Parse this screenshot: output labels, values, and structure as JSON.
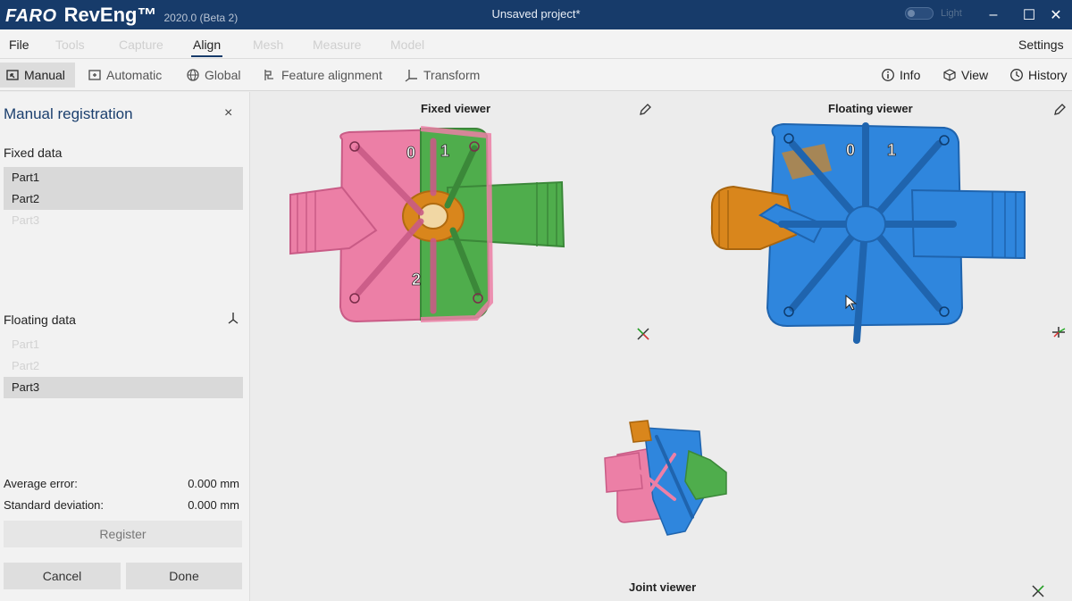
{
  "window": {
    "brand": "FARO",
    "product": "RevEng™",
    "version": "2020.0 (Beta 2)",
    "title": "Unsaved project*",
    "light_label": "Light",
    "minimize_glyph": "–",
    "maximize_glyph": "☐",
    "close_glyph": "✕"
  },
  "menu": {
    "file": "File",
    "items": [
      "Tools",
      "Capture",
      "Align",
      "Mesh",
      "Measure",
      "Model"
    ],
    "active": "Align",
    "settings": "Settings"
  },
  "toolbar": {
    "manual": "Manual",
    "automatic": "Automatic",
    "global": "Global",
    "feature": "Feature alignment",
    "transform": "Transform",
    "info": "Info",
    "view": "View",
    "history": "History"
  },
  "panel": {
    "title": "Manual registration",
    "close_glyph": "×",
    "fixed_label": "Fixed data",
    "fixed_items": [
      {
        "label": "Part1",
        "state": "selected"
      },
      {
        "label": "Part2",
        "state": "selected"
      },
      {
        "label": "Part3",
        "state": "disabled"
      }
    ],
    "floating_label": "Floating data",
    "floating_items": [
      {
        "label": "Part1",
        "state": "disabled"
      },
      {
        "label": "Part2",
        "state": "disabled"
      },
      {
        "label": "Part3",
        "state": "selected"
      }
    ],
    "avg_error_label": "Average error:",
    "avg_error_value": "0.000 mm",
    "std_dev_label": "Standard deviation:",
    "std_dev_value": "0.000 mm",
    "register": "Register",
    "cancel": "Cancel",
    "done": "Done"
  },
  "viewers": {
    "fixed_title": "Fixed viewer",
    "floating_title": "Floating viewer",
    "joint_title": "Joint viewer",
    "fixed_markers": [
      "0",
      "1",
      "2"
    ],
    "floating_markers": [
      "0",
      "1"
    ]
  },
  "colors": {
    "titlebar": "#173b6a",
    "part1_pink": "#ec7fa6",
    "part2_green": "#4fad4c",
    "part3_blue": "#2f86dd",
    "overlap_orange": "#d9861c"
  }
}
